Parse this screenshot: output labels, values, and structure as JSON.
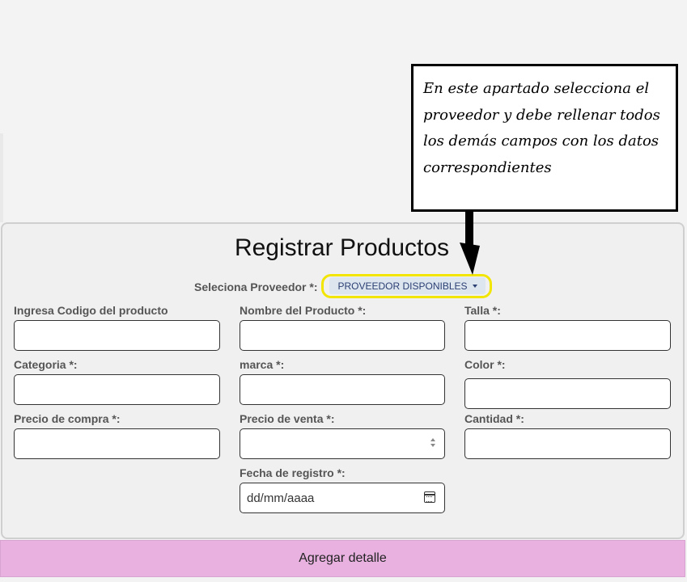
{
  "form": {
    "title": "Registrar Productos",
    "provider_label": "Seleciona Proveedor *:",
    "provider_dropdown": "PROVEEDOR DISPONIBLES",
    "fields": {
      "codigo": "Ingresa Codigo del producto",
      "nombre": "Nombre del Producto *:",
      "talla": "Talla *:",
      "categoria": "Categoria *:",
      "marca": "marca *:",
      "color": "Color *:",
      "precio_compra": "Precio de compra *:",
      "precio_venta": "Precio de venta *:",
      "cantidad": "Cantidad *:",
      "fecha_registro": "Fecha de registro *:"
    },
    "date_placeholder": "dd/mm/aaaa",
    "submit_label": "Agregar detalle"
  },
  "annotation": {
    "text": "En este apartado selecciona el proveedor y debe rellenar todos los demás campos con los datos correspondientes"
  },
  "colors": {
    "highlight": "#f2e500",
    "submit_bg": "#e8b1e0",
    "dropdown_bg": "#dde5ef"
  }
}
